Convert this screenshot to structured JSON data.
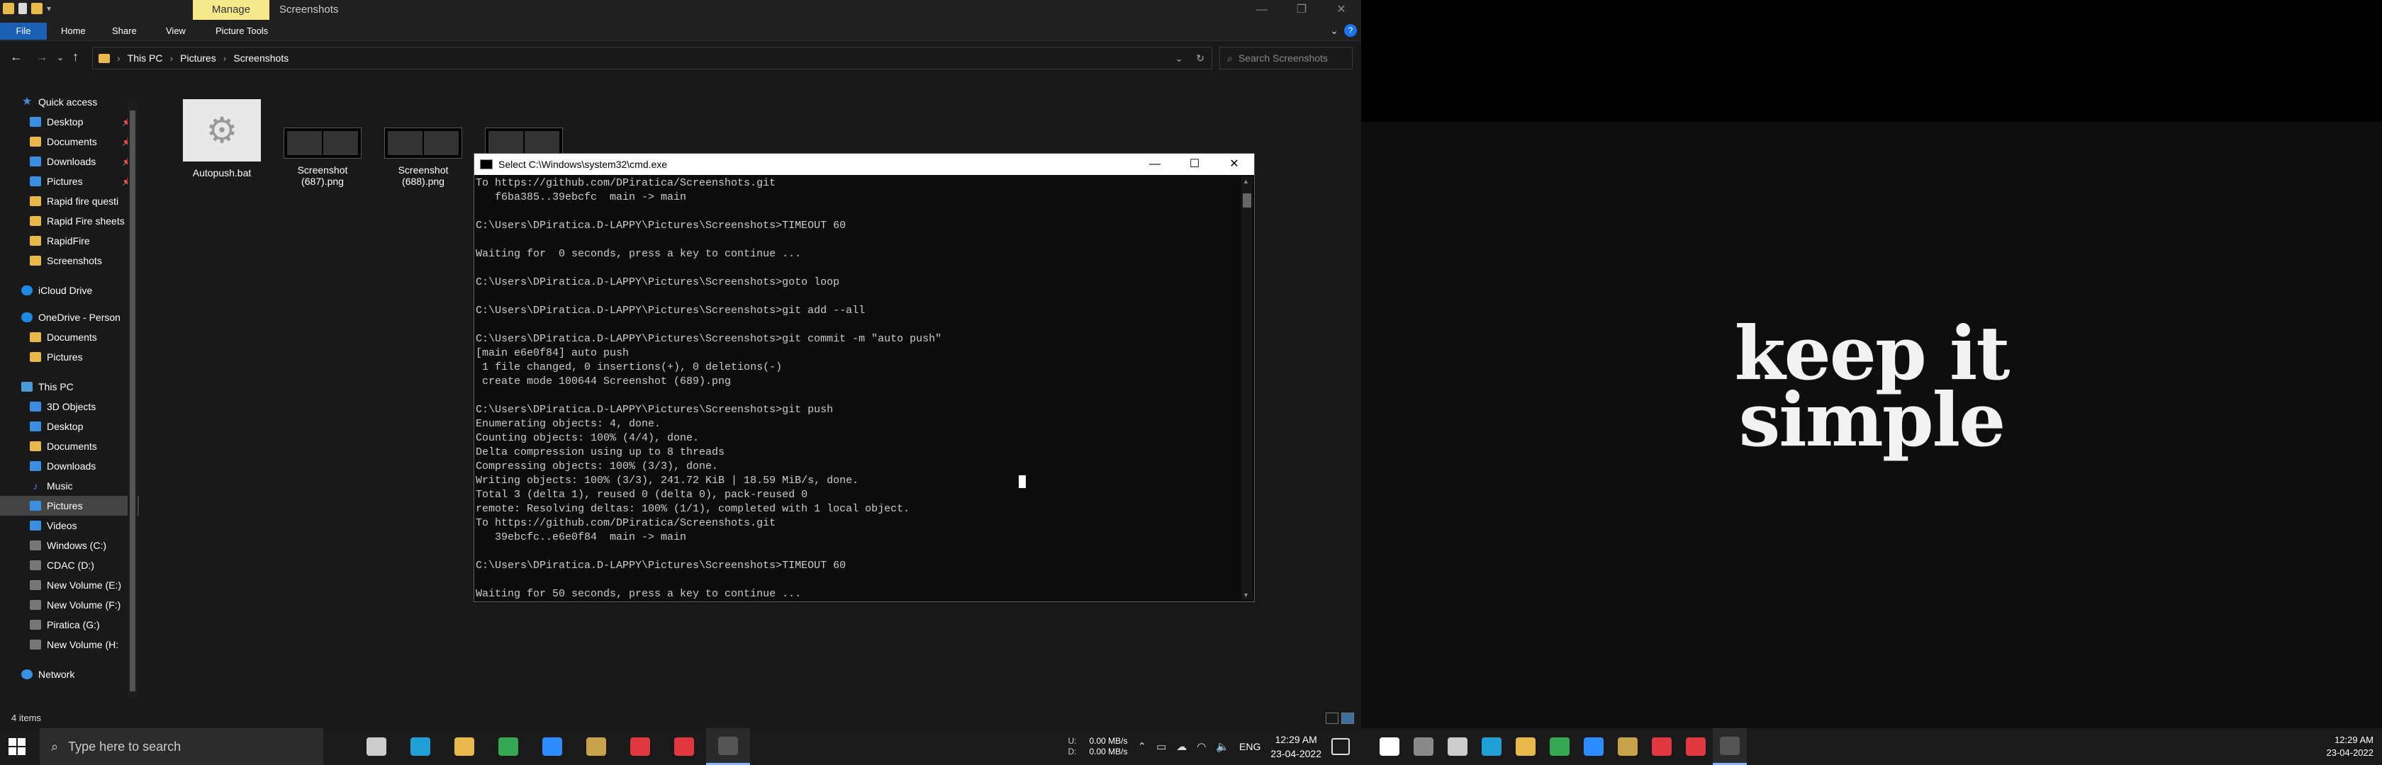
{
  "explorer": {
    "title": "Screenshots",
    "manage_tab": "Manage",
    "ribbon_tabs": [
      "File",
      "Home",
      "Share",
      "View",
      "Picture Tools"
    ],
    "address": {
      "crumbs": [
        "This PC",
        "Pictures",
        "Screenshots"
      ]
    },
    "search_placeholder": "Search Screenshots",
    "nav": {
      "quick_access": "Quick access",
      "qa_items": [
        "Desktop",
        "Documents",
        "Downloads",
        "Pictures",
        "Rapid fire questi",
        "Rapid Fire sheets",
        "RapidFire",
        "Screenshots"
      ],
      "icloud": "iCloud Drive",
      "onedrive": "OneDrive - Person",
      "onedrive_items": [
        "Documents",
        "Pictures"
      ],
      "this_pc": "This PC",
      "pc_items": [
        "3D Objects",
        "Desktop",
        "Documents",
        "Downloads",
        "Music",
        "Pictures",
        "Videos",
        "Windows (C:)",
        "CDAC (D:)",
        "New Volume (E:)",
        "New Volume (F:)",
        "Piratica (G:)",
        "New Volume (H:"
      ],
      "network": "Network"
    },
    "files": [
      {
        "name": "Autopush.bat"
      },
      {
        "name": "Screenshot (687).png"
      },
      {
        "name": "Screenshot (688).png"
      }
    ],
    "status": "4 items"
  },
  "cmd": {
    "title": "Select C:\\Windows\\system32\\cmd.exe",
    "lines": [
      "To https://github.com/DPiratica/Screenshots.git",
      "   f6ba385..39ebcfc  main -> main",
      "",
      "C:\\Users\\DPiratica.D-LAPPY\\Pictures\\Screenshots>TIMEOUT 60",
      "",
      "Waiting for  0 seconds, press a key to continue ...",
      "",
      "C:\\Users\\DPiratica.D-LAPPY\\Pictures\\Screenshots>goto loop",
      "",
      "C:\\Users\\DPiratica.D-LAPPY\\Pictures\\Screenshots>git add --all",
      "",
      "C:\\Users\\DPiratica.D-LAPPY\\Pictures\\Screenshots>git commit -m \"auto push\"",
      "[main e6e0f84] auto push",
      " 1 file changed, 0 insertions(+), 0 deletions(-)",
      " create mode 100644 Screenshot (689).png",
      "",
      "C:\\Users\\DPiratica.D-LAPPY\\Pictures\\Screenshots>git push",
      "Enumerating objects: 4, done.",
      "Counting objects: 100% (4/4), done.",
      "Delta compression using up to 8 threads",
      "Compressing objects: 100% (3/3), done.",
      "Writing objects: 100% (3/3), 241.72 KiB | 18.59 MiB/s, done.",
      "Total 3 (delta 1), reused 0 (delta 0), pack-reused 0",
      "remote: Resolving deltas: 100% (1/1), completed with 1 local object.",
      "To https://github.com/DPiratica/Screenshots.git",
      "   39ebcfc..e6e0f84  main -> main",
      "",
      "C:\\Users\\DPiratica.D-LAPPY\\Pictures\\Screenshots>TIMEOUT 60",
      "",
      "Waiting for 50 seconds, press a key to continue ..."
    ]
  },
  "taskbar": {
    "search_placeholder": "Type here to search",
    "apps": [
      {
        "name": "task-view",
        "color": "#cccccc"
      },
      {
        "name": "edge",
        "color": "#1fa0d6"
      },
      {
        "name": "file-explorer",
        "color": "#e8b84b"
      },
      {
        "name": "chrome",
        "color": "#34a853"
      },
      {
        "name": "zoom",
        "color": "#2d8cff"
      },
      {
        "name": "git-gui",
        "color": "#c7a24a"
      },
      {
        "name": "anydesk-1",
        "color": "#e0383e"
      },
      {
        "name": "anydesk-2",
        "color": "#e0383e"
      },
      {
        "name": "cmd",
        "color": "#555555"
      }
    ],
    "net": {
      "up_label": "U:",
      "down_label": "D:",
      "up": "0.00 MB/s",
      "down": "0.00 MB/s"
    },
    "lang": "ENG",
    "time": "12:29 AM",
    "date": "23-04-2022"
  },
  "monitor2": {
    "wallpaper_line1": "keep it",
    "wallpaper_line2": "simple",
    "time": "12:29 AM",
    "date": "23-04-2022"
  }
}
